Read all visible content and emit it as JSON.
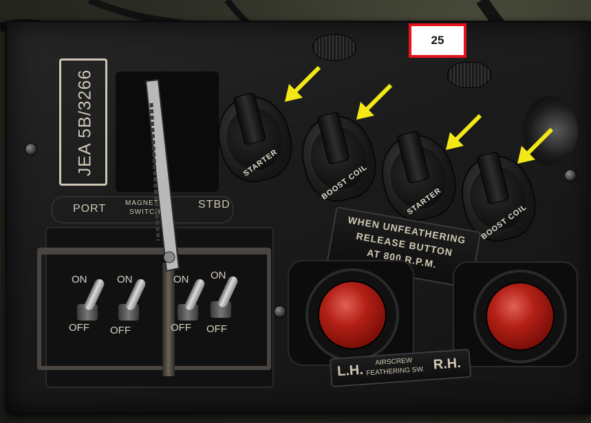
{
  "callout": {
    "number": "25"
  },
  "decals": {
    "model_plate": "JEA 5B/3266",
    "port": "PORT",
    "magneto_line1": "MAGNETO",
    "magneto_line2": "SWITCH",
    "stbd": "STBD"
  },
  "rotary_switches": [
    {
      "label": "STARTER"
    },
    {
      "label": "BOOST COIL"
    },
    {
      "label": "STARTER"
    },
    {
      "label": "BOOST COIL"
    }
  ],
  "magneto_toggles": [
    {
      "on": "ON",
      "off": "OFF"
    },
    {
      "on": "ON",
      "off": "OFF"
    },
    {
      "on": "ON",
      "off": "OFF"
    },
    {
      "on": "ON",
      "off": "OFF"
    }
  ],
  "feathering_placard": {
    "line1": "WHEN UNFEATHERING",
    "line2": "RELEASE BUTTON",
    "line3": "AT 800 R.P.M."
  },
  "feathering_label": {
    "left": "L.H.",
    "middle_line1": "AIRSCREW",
    "middle_line2": "FEATHERING SW.",
    "right": "R.H."
  },
  "colors": {
    "arrow": "#f4e718",
    "callout_border": "#e3141b",
    "button_red": "#b32016"
  }
}
